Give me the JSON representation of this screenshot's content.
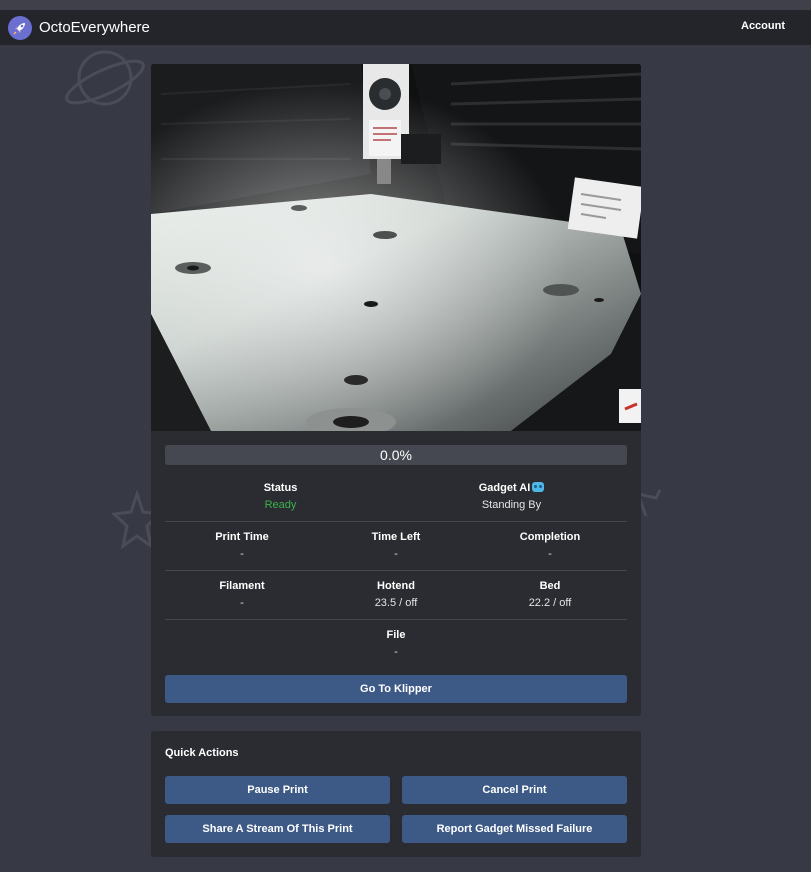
{
  "navbar": {
    "brand": "OctoEverywhere",
    "account_label": "Account"
  },
  "camera": {
    "description_icon": "webcam-stream"
  },
  "progress": {
    "value": 0.0,
    "label": "0.0%"
  },
  "stats": {
    "status": {
      "label": "Status",
      "value": "Ready"
    },
    "gadget": {
      "label": "Gadget AI",
      "value": "Standing By"
    },
    "print_time": {
      "label": "Print Time",
      "value": "-"
    },
    "time_left": {
      "label": "Time Left",
      "value": "-"
    },
    "completion": {
      "label": "Completion",
      "value": "-"
    },
    "filament": {
      "label": "Filament",
      "value": "-"
    },
    "hotend": {
      "label": "Hotend",
      "value": "23.5 / off"
    },
    "bed": {
      "label": "Bed",
      "value": "22.2 / off"
    },
    "file": {
      "label": "File",
      "value": "-"
    }
  },
  "buttons": {
    "go_to_klipper": "Go To Klipper"
  },
  "quick_actions": {
    "title": "Quick Actions",
    "pause": "Pause Print",
    "cancel": "Cancel Print",
    "share": "Share A Stream Of This Print",
    "report": "Report Gadget Missed Failure"
  },
  "colors": {
    "background": "#373a45",
    "navbar": "#23252b",
    "card": "#2a2c32",
    "button": "#3d5a87",
    "status_ready": "#3bb24a",
    "gadget_icon": "#4fb7e8"
  }
}
